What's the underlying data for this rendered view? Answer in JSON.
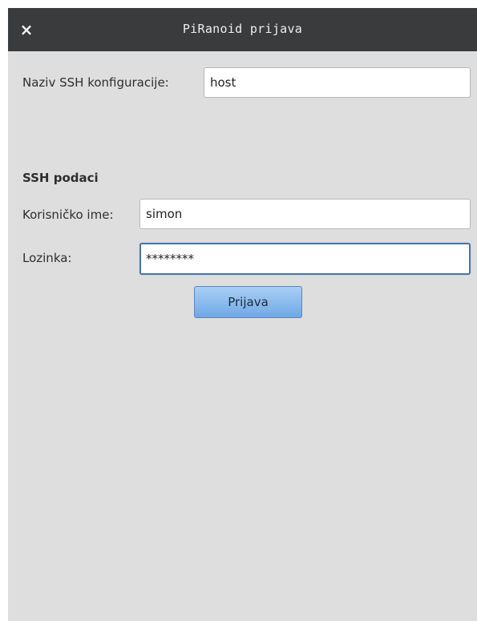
{
  "window": {
    "title": "PiRanoid prijava",
    "close_icon": "×"
  },
  "config": {
    "label": "Naziv SSH konfiguracije:",
    "value": "host"
  },
  "ssh": {
    "section_title": "SSH podaci",
    "username_label": "Korisničko ime:",
    "username_value": "simon",
    "password_label": "Lozinka:",
    "password_value": "********"
  },
  "actions": {
    "login_label": "Prijava"
  }
}
